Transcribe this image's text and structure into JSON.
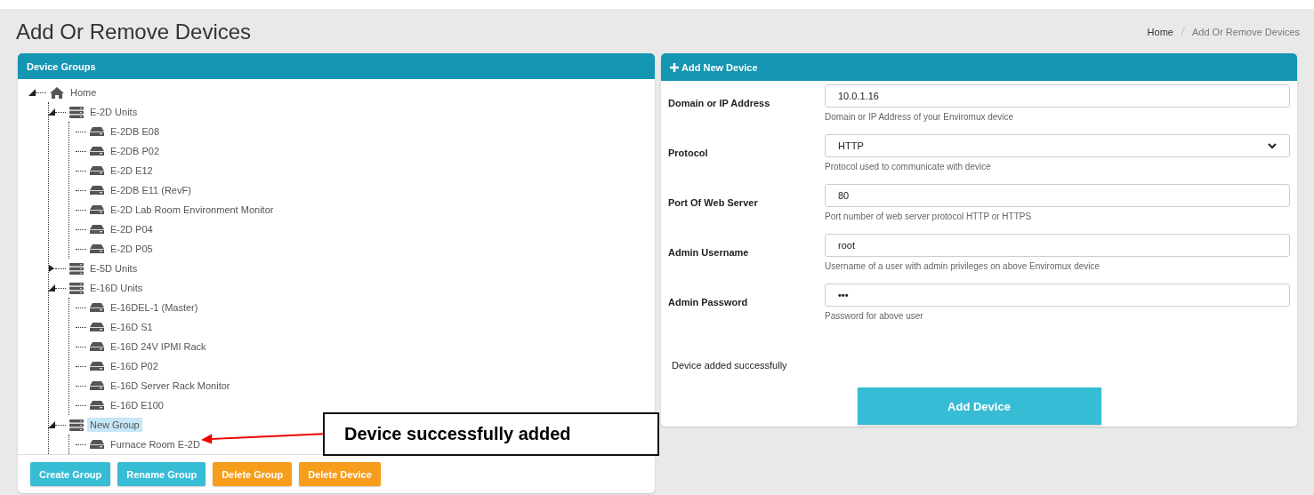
{
  "page_title": "Add Or Remove Devices",
  "breadcrumb": [
    {
      "label": "Home",
      "selected": false
    },
    {
      "label": "Add Or Remove Devices",
      "selected": true
    }
  ],
  "device_groups": {
    "title": "Device Groups",
    "tree": [
      {
        "kind": "home",
        "label": "Home",
        "expanded": true,
        "selected": false,
        "children": [
          {
            "kind": "group",
            "label": "E-2D Units",
            "expanded": true,
            "selected": false,
            "children": [
              {
                "kind": "device",
                "label": "E-2DB E08",
                "selected": false
              },
              {
                "kind": "device",
                "label": "E-2DB P02",
                "selected": false
              },
              {
                "kind": "device",
                "label": "E-2D E12",
                "selected": false
              },
              {
                "kind": "device",
                "label": "E-2DB E11 (RevF)",
                "selected": false
              },
              {
                "kind": "device",
                "label": "E-2D Lab Room Environment Monitor",
                "selected": false
              },
              {
                "kind": "device",
                "label": "E-2D P04",
                "selected": false
              },
              {
                "kind": "device",
                "label": "E-2D P05",
                "selected": false
              }
            ]
          },
          {
            "kind": "group",
            "label": "E-5D Units",
            "expanded": false,
            "selected": false
          },
          {
            "kind": "group",
            "label": "E-16D Units",
            "expanded": true,
            "selected": false,
            "children": [
              {
                "kind": "device",
                "label": "E-16DEL-1 (Master)",
                "selected": false
              },
              {
                "kind": "device",
                "label": "E-16D S1",
                "selected": false
              },
              {
                "kind": "device",
                "label": "E-16D 24V IPMI Rack",
                "selected": false
              },
              {
                "kind": "device",
                "label": "E-16D P02",
                "selected": false
              },
              {
                "kind": "device",
                "label": "E-16D Server Rack Monitor",
                "selected": false
              },
              {
                "kind": "device",
                "label": "E-16D E100",
                "selected": false
              }
            ]
          },
          {
            "kind": "group",
            "label": "New Group",
            "expanded": true,
            "selected": true,
            "children": [
              {
                "kind": "device",
                "label": "Furnace Room E-2D",
                "selected": false
              }
            ]
          }
        ]
      }
    ],
    "buttons": [
      {
        "label": "Create Group",
        "kind": "info"
      },
      {
        "label": "Rename Group",
        "kind": "info"
      },
      {
        "label": "Delete Group",
        "kind": "warning"
      },
      {
        "label": "Delete Device",
        "kind": "warning"
      }
    ]
  },
  "add_device": {
    "title": "Add New Device",
    "fields": [
      {
        "label": "Domain or IP Address",
        "kind": "text",
        "value": "10.0.1.16",
        "help": "Domain or IP Address of your Enviromux device"
      },
      {
        "label": "Protocol",
        "kind": "select",
        "value": "HTTP",
        "help": "Protocol used to communicate with device"
      },
      {
        "label": "Port Of Web Server",
        "kind": "text",
        "value": "80",
        "help": "Port number of web server protocol HTTP or HTTPS"
      },
      {
        "label": "Admin Username",
        "kind": "text",
        "value": "root",
        "help": "Username of a user with admin privileges on above Enviromux device"
      },
      {
        "label": "Admin Password",
        "kind": "password",
        "value": "•••",
        "help": "Password for above user"
      }
    ],
    "status": "Device added successfully",
    "submit": "Add Device"
  },
  "callout": "Device successfully added"
}
